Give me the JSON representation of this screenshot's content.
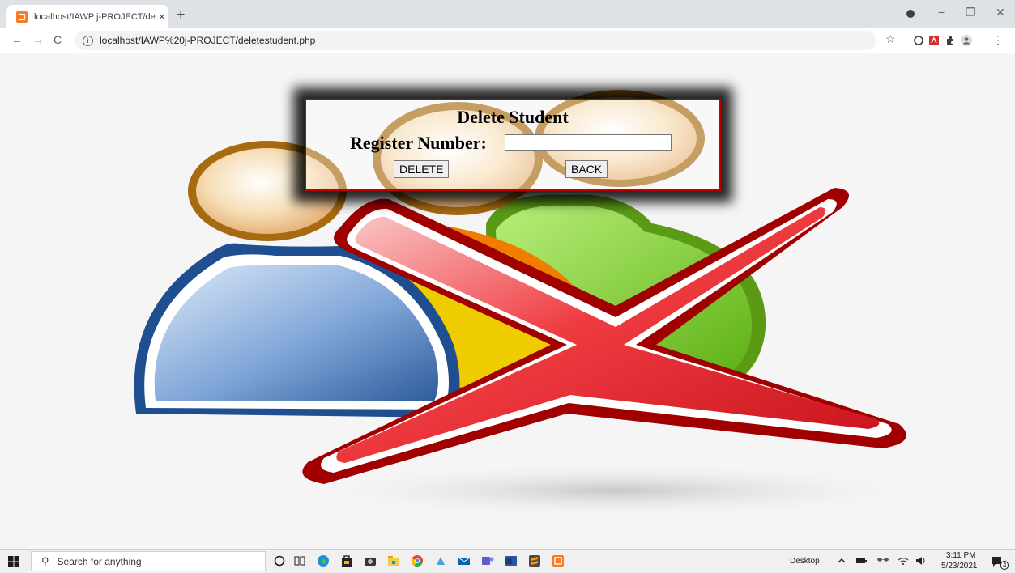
{
  "browser": {
    "tab_title": "localhost/IAWP j-PROJECT/delete",
    "tab_close": "×",
    "new_tab": "+",
    "url": "localhost/IAWP%20j-PROJECT/deletestudent.php",
    "nav_back": "←",
    "nav_forward": "→",
    "nav_reload": "C",
    "info_glyph": "i",
    "bookmark_star": "☆",
    "win_minimize": "−",
    "win_restore": "❐",
    "win_close": "✕",
    "menu_dots": "⋮"
  },
  "form": {
    "title": "Delete Student",
    "label": "Register Number:",
    "input_value": "",
    "delete_label": "DELETE",
    "back_label": "BACK"
  },
  "taskbar": {
    "search_placeholder": "Search for anything",
    "search_glyph": "⚲",
    "desktop_label": "Desktop",
    "time": "3:11 PM",
    "date": "5/23/2021",
    "notification_count": "4",
    "icons": [
      "cortana-icon",
      "task-view-icon",
      "edge-icon",
      "store-icon",
      "camera-icon",
      "file-explorer-icon",
      "chrome-icon",
      "photos-icon",
      "mail-icon",
      "teams-icon",
      "word-icon",
      "sublime-icon",
      "xampp-icon"
    ]
  },
  "colors": {
    "form_border": "#c00000",
    "cross_red": "#e8232a",
    "cross_dark": "#a00000",
    "person_blue": "#3f73b5",
    "person_yellow": "#f0d000",
    "person_green": "#6cc41a",
    "head_tan": "#f3d9b0"
  }
}
